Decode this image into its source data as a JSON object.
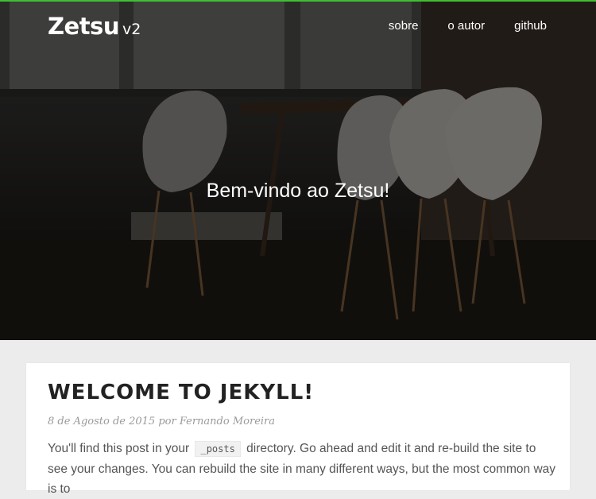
{
  "brand": {
    "name": "Zetsu",
    "version": "v2"
  },
  "nav": {
    "items": [
      "sobre",
      "o autor",
      "github"
    ]
  },
  "hero": {
    "title": "Bem-vindo ao Zetsu!"
  },
  "post": {
    "title": "WELCOME TO JEKYLL!",
    "date": "8 de Agosto de 2015",
    "by": "por",
    "author": "Fernando Moreira",
    "excerpt_before": "You'll find this post in your",
    "code": "_posts",
    "excerpt_after": "directory. Go ahead and edit it and re-build the site to see your changes. You can rebuild the site in many different ways, but the most common way is to"
  },
  "colors": {
    "accent": "#3fbf2f",
    "background": "#ececec"
  }
}
